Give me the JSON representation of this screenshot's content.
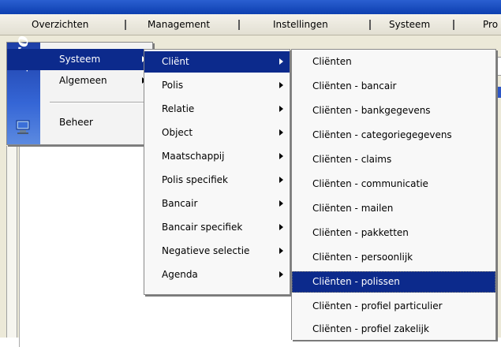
{
  "menubar": {
    "items": [
      "Overzichten",
      "Management",
      "Instellingen",
      "Systeem",
      "Pro"
    ]
  },
  "logo": {
    "text": "Pro"
  },
  "menu1": {
    "items": [
      {
        "label": "Systeem",
        "submenu": true,
        "highlighted": true
      },
      {
        "label": "Algemeen",
        "submenu": true,
        "highlighted": false
      },
      {
        "label": "Beheer",
        "submenu": false,
        "highlighted": false
      }
    ]
  },
  "menu2": {
    "items": [
      {
        "label": "Cliënt",
        "submenu": true,
        "highlighted": true
      },
      {
        "label": "Polis",
        "submenu": true
      },
      {
        "label": "Relatie",
        "submenu": true
      },
      {
        "label": "Object",
        "submenu": true
      },
      {
        "label": "Maatschappij",
        "submenu": true
      },
      {
        "label": "Polis specifiek",
        "submenu": true
      },
      {
        "label": "Bancair",
        "submenu": true
      },
      {
        "label": "Bancair specifiek",
        "submenu": true
      },
      {
        "label": "Negatieve selectie",
        "submenu": true
      },
      {
        "label": "Agenda",
        "submenu": true
      }
    ]
  },
  "menu3": {
    "items": [
      {
        "label": "Cliënten"
      },
      {
        "label": "Cliënten - bancair"
      },
      {
        "label": "Cliënten - bankgegevens"
      },
      {
        "label": "Cliënten - categoriegegevens"
      },
      {
        "label": "Cliënten - claims"
      },
      {
        "label": "Cliënten - communicatie"
      },
      {
        "label": "Cliënten - mailen"
      },
      {
        "label": "Cliënten - pakketten"
      },
      {
        "label": "Cliënten - persoonlijk"
      },
      {
        "label": "Cliënten - polissen",
        "highlighted": true
      },
      {
        "label": "Cliënten - profiel particulier"
      },
      {
        "label": "Cliënten - profiel zakelijk"
      }
    ]
  },
  "colors": {
    "highlight": "#0c2a8c",
    "titlebar": "#1a4fc4",
    "logo": "#2a55c8"
  }
}
